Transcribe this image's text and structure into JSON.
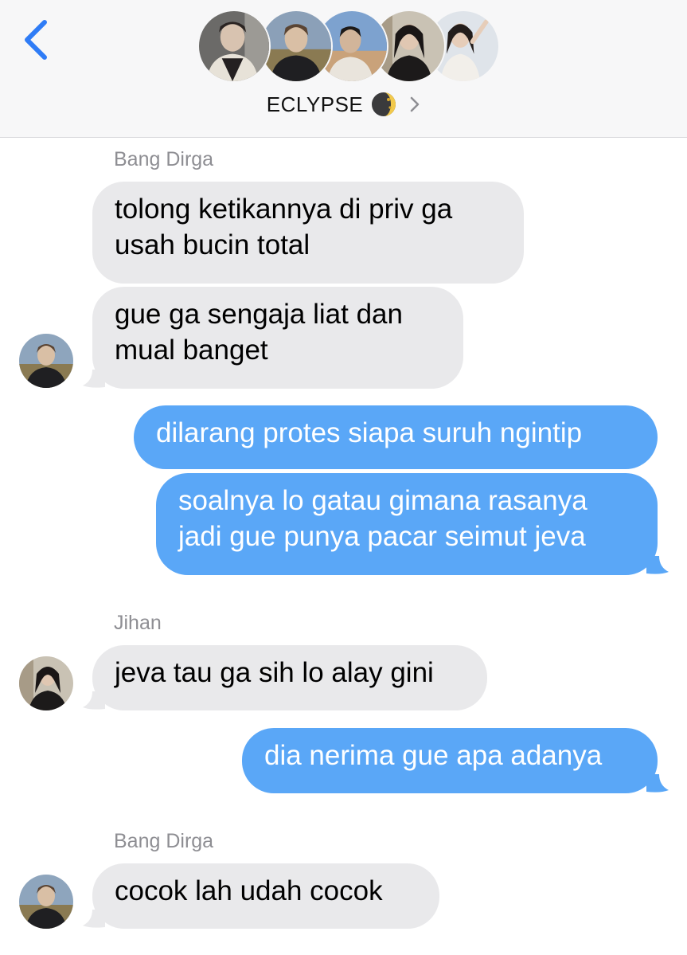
{
  "header": {
    "group_name": "ECLYPSE",
    "title_icon": "moon-icon",
    "back_icon": "chevron-left-icon",
    "disclosure_icon": "chevron-right-icon",
    "member_avatar_count": 5
  },
  "messages": [
    {
      "sender": "Bang Dirga",
      "direction": "incoming",
      "text": [
        "tolong ketikannya di priv ga",
        "usah bucin total"
      ]
    },
    {
      "sender": "Bang Dirga",
      "direction": "incoming",
      "text": [
        "gue ga sengaja liat dan",
        "mual banget"
      ]
    },
    {
      "sender": "me",
      "direction": "outgoing",
      "text": [
        "dilarang protes siapa suruh ngintip"
      ]
    },
    {
      "sender": "me",
      "direction": "outgoing",
      "text": [
        "soalnya lo gatau gimana rasanya",
        "jadi gue punya pacar seimut jeva"
      ]
    },
    {
      "sender": "Jihan",
      "direction": "incoming",
      "text": [
        "jeva tau ga sih lo alay gini"
      ]
    },
    {
      "sender": "me",
      "direction": "outgoing",
      "text": [
        "dia nerima gue apa adanya"
      ]
    },
    {
      "sender": "Bang Dirga",
      "direction": "incoming",
      "text": [
        "cocok lah udah cocok"
      ]
    }
  ],
  "colors": {
    "outgoing_bubble": "#5aa7f7",
    "incoming_bubble": "#e9e9eb",
    "accent": "#2f7cf6",
    "sender_label": "#8e8e93"
  }
}
